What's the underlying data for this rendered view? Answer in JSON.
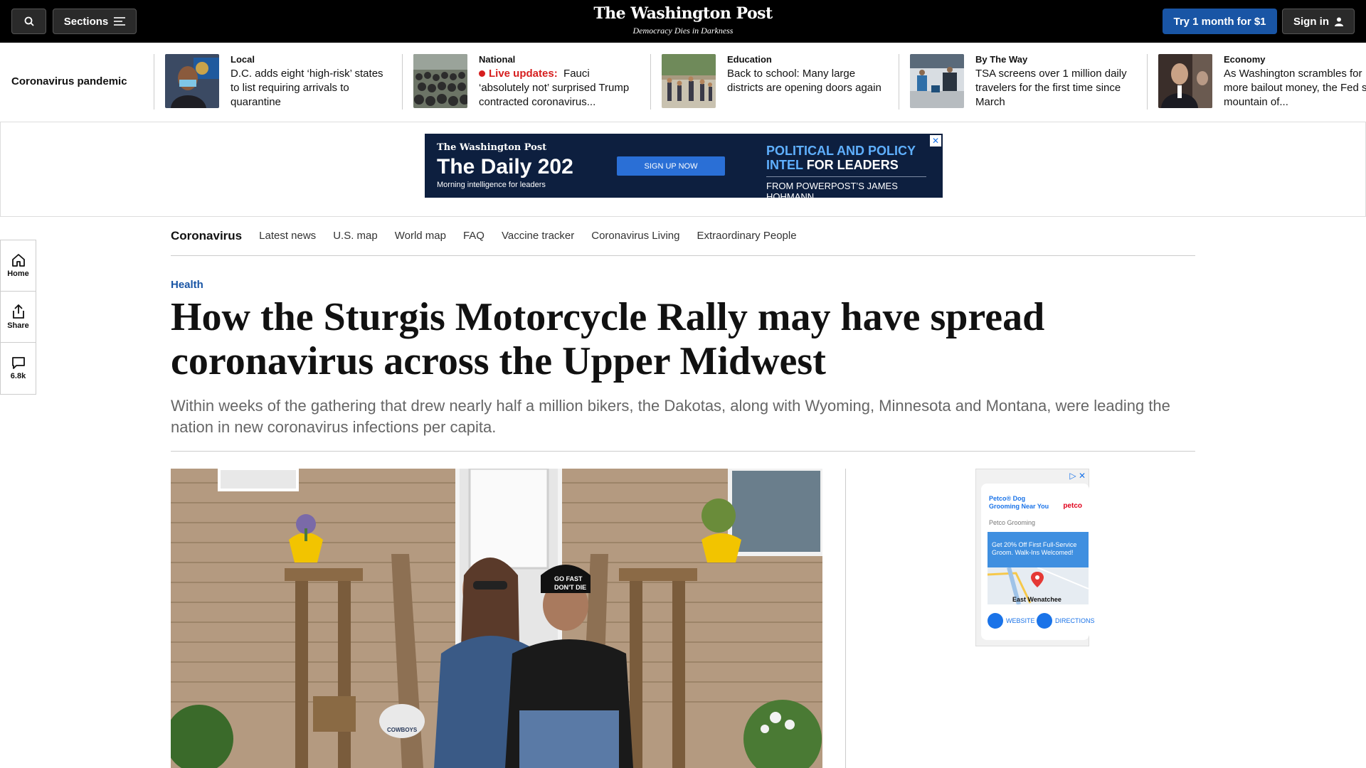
{
  "topbar": {
    "sections_label": "Sections",
    "logo": "The Washington Post",
    "tagline": "Democracy Dies in Darkness",
    "try_label": "Try 1 month for $1",
    "signin_label": "Sign in"
  },
  "strip": {
    "label": "Coronavirus pandemic",
    "items": [
      {
        "kicker": "Local",
        "headline": "D.C. adds eight ‘high-risk’ states to list requiring arrivals to quarantine"
      },
      {
        "kicker": "National",
        "live": "Live updates:",
        "headline": "Fauci ‘absolutely not’ surprised Trump contracted coronavirus..."
      },
      {
        "kicker": "Education",
        "headline": "Back to school: Many large districts are opening doors again"
      },
      {
        "kicker": "By The Way",
        "headline": "TSA screens over 1 million daily travelers for the first time since March"
      },
      {
        "kicker": "Economy",
        "headline": "As Washington scrambles for more bailout money, the Fed s on mountain of..."
      }
    ]
  },
  "banner_ad": {
    "logo": "The Washington Post",
    "title": "The Daily 202",
    "subtitle": "Morning intelligence for leaders",
    "cta": "SIGN UP NOW",
    "pitch_1": "POLITICAL AND POLICY",
    "pitch_2a": "INTEL",
    "pitch_2b": "FOR LEADERS",
    "from": "FROM POWERPOST’S JAMES HOHMANN"
  },
  "rail": {
    "home": "Home",
    "share": "Share",
    "comments": "6.8k"
  },
  "subnav": {
    "brand": "Coronavirus",
    "links": [
      "Latest news",
      "U.S. map",
      "World map",
      "FAQ",
      "Vaccine tracker",
      "Coronavirus Living",
      "Extraordinary People"
    ]
  },
  "article": {
    "kicker": "Health",
    "headline": "How the Sturgis Motorcycle Rally may have spread coronavirus across the Upper Midwest",
    "dek": "Within weeks of the gathering that drew nearly half a million bikers, the Dakotas, along with Wyoming, Minnesota and Montana, were leading the nation in new coronavirus infections per capita."
  },
  "photo": {
    "cap_text": "GO FAST DON'T DIE",
    "plaque": "COWBOYS"
  },
  "side_ad": {
    "title": "Petco® Dog Grooming Near You",
    "brand": "petco",
    "source": "Petco Grooming",
    "offer": "Get 20% Off First Full-Service Groom. Walk-Ins Welcomed!",
    "map_label": "East Wenatchee",
    "website": "WEBSITE",
    "directions": "DIRECTIONS"
  },
  "colors": {
    "brand_blue": "#1955a5",
    "live_red": "#d61e1e"
  }
}
